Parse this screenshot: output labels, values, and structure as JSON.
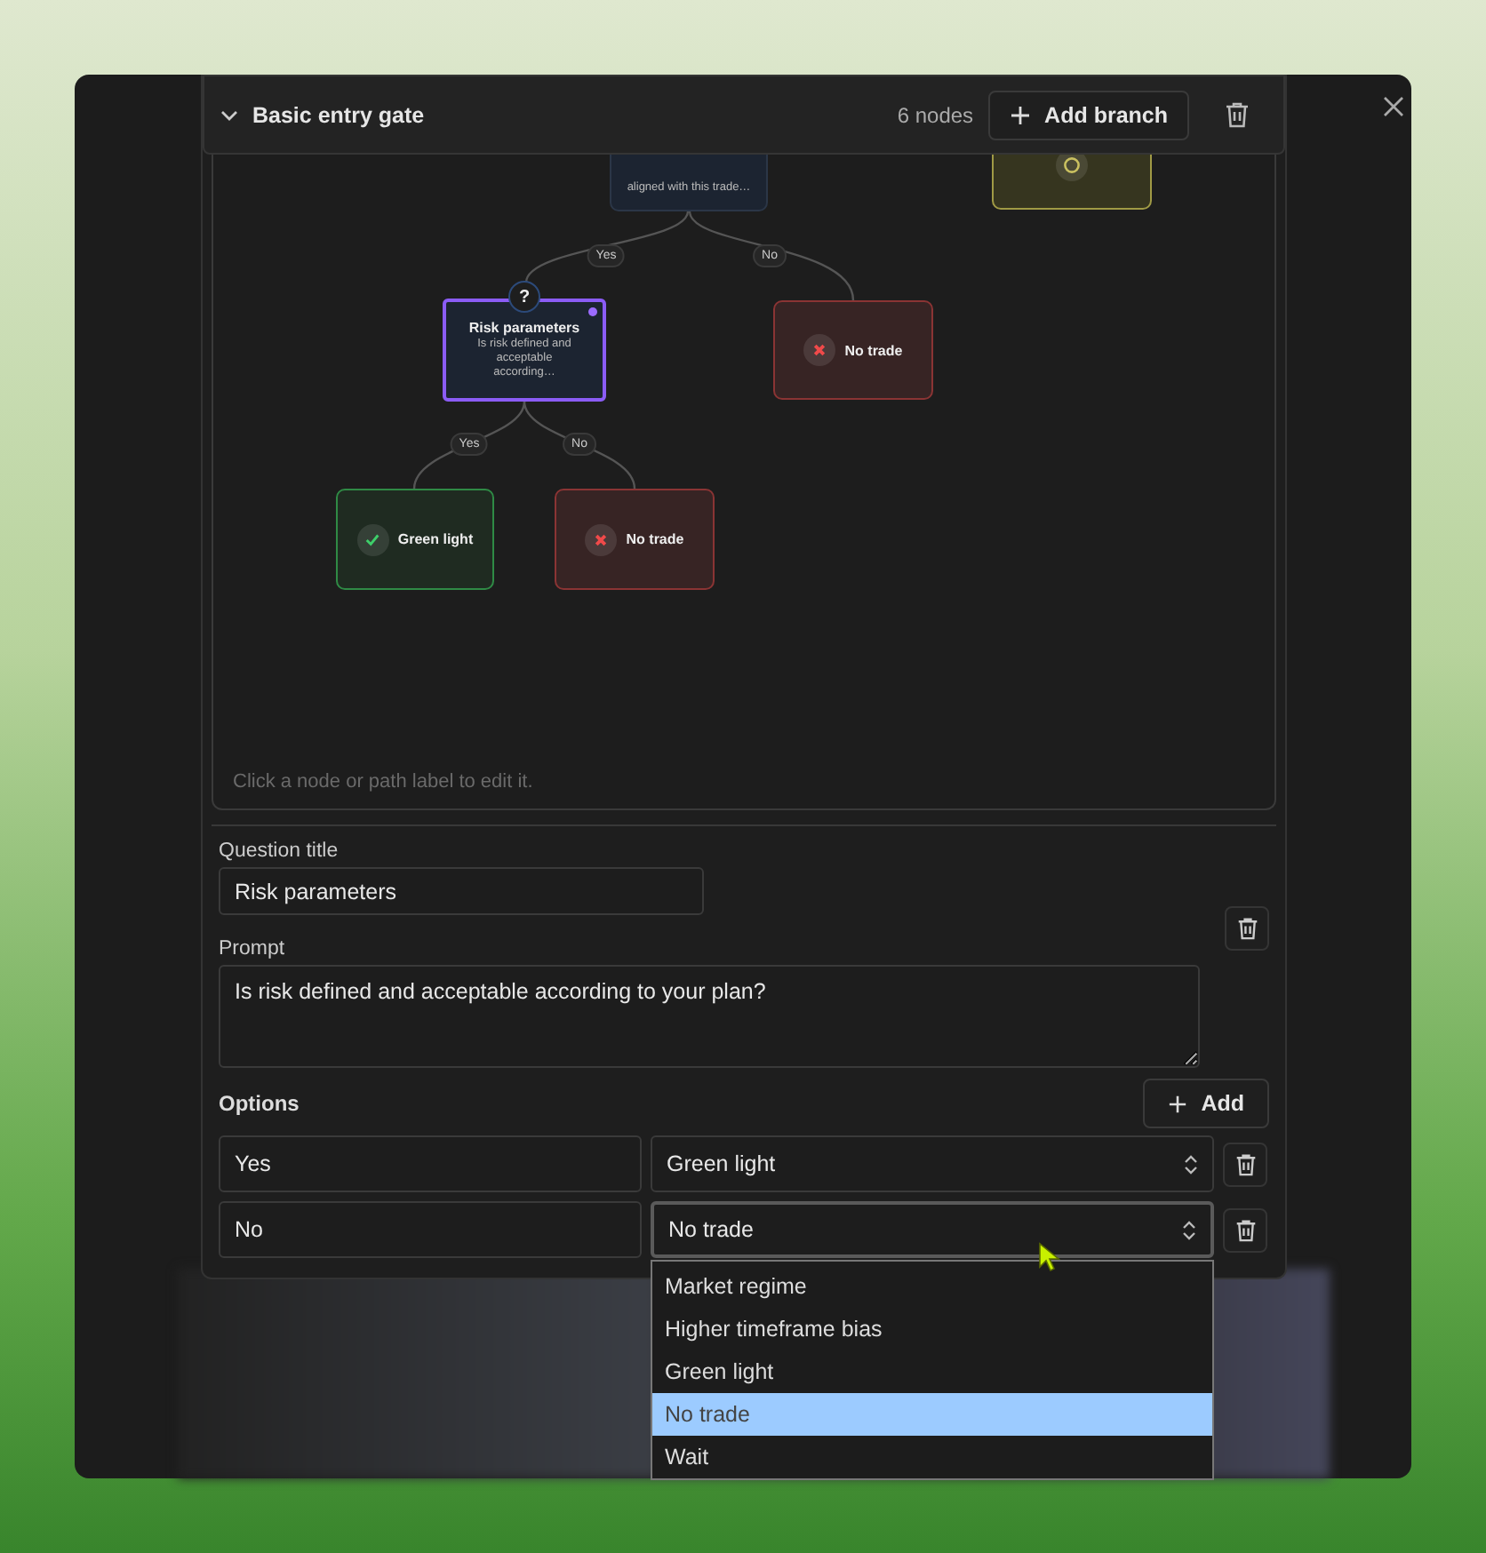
{
  "gate": {
    "title": "Basic entry gate",
    "expanded": true,
    "count": "6 nodes",
    "add_label": "Add branch"
  },
  "canvas": {
    "nodes": [
      {
        "kind": "question",
        "prompt": "aligned with this trade…",
        "selected": false
      },
      {
        "kind": "wait",
        "selected": false
      },
      {
        "kind": "question",
        "badge": "?",
        "title": "Risk parameters",
        "prompt": "Is risk defined and acceptable according…",
        "selected": true
      },
      {
        "kind": "stop",
        "title": "No trade",
        "selected": false
      },
      {
        "kind": "go",
        "title": "Green light",
        "selected": false
      },
      {
        "kind": "stop",
        "title": "No trade",
        "selected": false
      }
    ],
    "edge_labels": [
      "Yes",
      "No",
      "Yes",
      "No"
    ],
    "hint": "Click a node or path label to edit it."
  },
  "editor": {
    "title_label": "Question title",
    "title_value": "Risk parameters",
    "prompt_label": "Prompt",
    "prompt_value": "Is risk defined and acceptable according to your plan?",
    "options_label": "Options",
    "add_label": "Add",
    "options": [
      {
        "answer": "Yes",
        "target": "Green light",
        "open": false
      },
      {
        "answer": "No",
        "target": "No trade",
        "open": true
      }
    ],
    "dropdown": [
      {
        "label": "Market regime",
        "selected": false
      },
      {
        "label": "Higher timeframe bias",
        "selected": false
      },
      {
        "label": "Green light",
        "selected": false
      },
      {
        "label": "No trade",
        "selected": true
      },
      {
        "label": "Wait",
        "selected": false
      }
    ]
  }
}
